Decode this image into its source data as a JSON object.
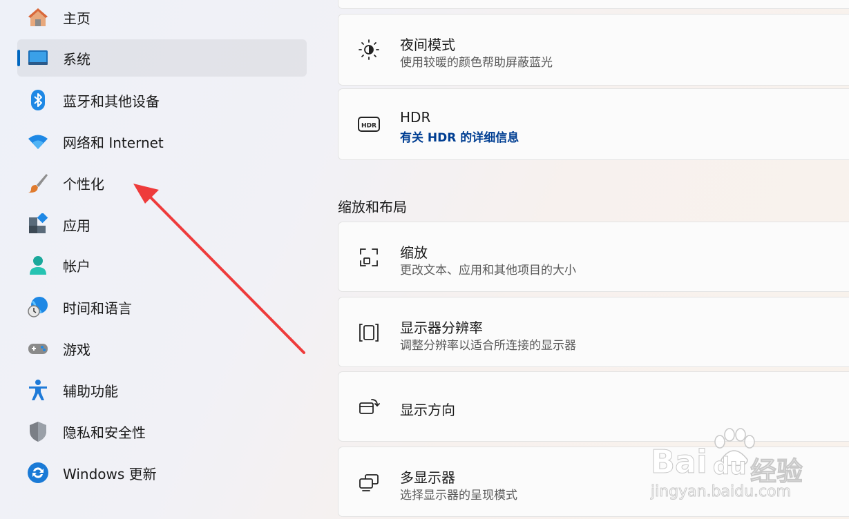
{
  "sidebar": {
    "items": [
      {
        "label": "主页",
        "icon": "home-icon"
      },
      {
        "label": "系统",
        "icon": "system-display-icon",
        "selected": true
      },
      {
        "label": "蓝牙和其他设备",
        "icon": "bluetooth-icon"
      },
      {
        "label": "网络和 Internet",
        "icon": "wifi-icon"
      },
      {
        "label": "个性化",
        "icon": "paintbrush-icon"
      },
      {
        "label": "应用",
        "icon": "apps-icon"
      },
      {
        "label": "帐户",
        "icon": "account-icon"
      },
      {
        "label": "时间和语言",
        "icon": "globe-clock-icon"
      },
      {
        "label": "游戏",
        "icon": "gamepad-icon"
      },
      {
        "label": "辅助功能",
        "icon": "accessibility-icon"
      },
      {
        "label": "隐私和安全性",
        "icon": "shield-icon"
      },
      {
        "label": "Windows 更新",
        "icon": "update-icon"
      }
    ]
  },
  "main": {
    "night_light": {
      "title": "夜间模式",
      "subtitle": "使用较暖的颜色帮助屏蔽蓝光",
      "icon": "brightness-icon"
    },
    "hdr": {
      "title": "HDR",
      "link": "有关 HDR 的详细信息",
      "icon": "hdr-icon",
      "icon_text": "HDR"
    },
    "section_scale_layout": "缩放和布局",
    "scale": {
      "title": "缩放",
      "subtitle": "更改文本、应用和其他项目的大小",
      "icon": "scale-icon"
    },
    "resolution": {
      "title": "显示器分辨率",
      "subtitle": "调整分辨率以适合所连接的显示器",
      "icon": "resolution-icon"
    },
    "orientation": {
      "title": "显示方向",
      "icon": "rotate-screen-icon"
    },
    "multiple_displays": {
      "title": "多显示器",
      "subtitle": "选择显示器的呈现模式",
      "icon": "multi-display-icon"
    }
  },
  "annotation": {
    "arrow_color": "#ee3b3b",
    "target": "个性化"
  },
  "watermark": {
    "brand": "Bai",
    "brand2": "du",
    "brand_cn": "经验",
    "url": "jingyan.baidu.com"
  },
  "colors": {
    "accent": "#0067c0",
    "link": "#003e92"
  }
}
